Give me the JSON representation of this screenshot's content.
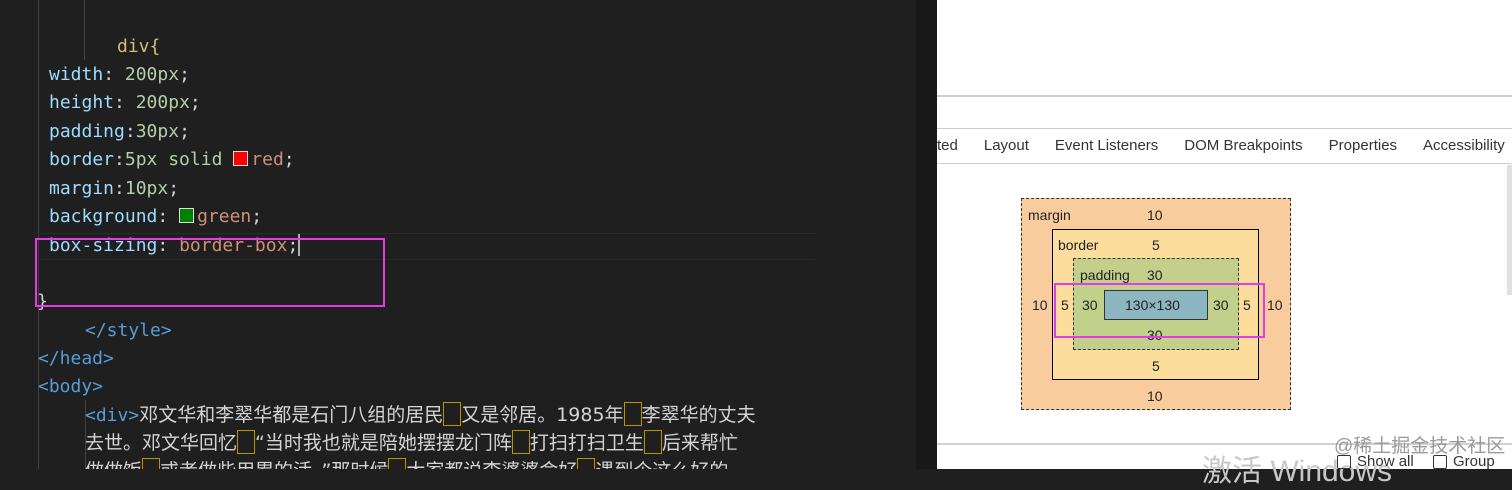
{
  "editor": {
    "selector": "div{",
    "decls": [
      {
        "prop": "width",
        "sep": ": ",
        "value": "200px",
        "end": ";"
      },
      {
        "prop": "height",
        "sep": ": ",
        "value": "200px",
        "end": ";"
      },
      {
        "prop": "padding",
        "sep": ":",
        "value": "30px",
        "end": ";"
      },
      {
        "prop": "border",
        "sep": ":",
        "value": "5px solid",
        "swatch": "#ff0000",
        "value2": "red",
        "end": ";"
      },
      {
        "prop": "margin",
        "sep": ":",
        "value": "10px",
        "end": ";"
      },
      {
        "prop": "background",
        "sep": ": ",
        "swatch": "#008000",
        "value2": "green",
        "end": ";"
      },
      {
        "prop": "box-sizing",
        "sep": ": ",
        "value": "border-box",
        "end": ";"
      }
    ],
    "close_brace": "}",
    "style_close": "</style>",
    "head_close": "</head>",
    "body_open": "<body>",
    "div_open": "<div>",
    "text_lines": [
      [
        "邓文华和李翠华都是石门八组的居民",
        "，",
        "又是邻居。1985年",
        "，",
        "李翠华的丈夫"
      ],
      [
        "去世。邓文华回忆",
        "，",
        "“当时我也就是陪她摆摆龙门阵",
        "，",
        "打扫打扫卫生",
        "，",
        "后来帮忙"
      ],
      [
        "做做饭",
        "，",
        "或者做些用累的活。”那时候",
        "，",
        "大家都说李婆婆命好",
        "，",
        "遇到个这么好的"
      ]
    ]
  },
  "devtools": {
    "tabs": [
      "ted",
      "Layout",
      "Event Listeners",
      "DOM Breakpoints",
      "Properties",
      "Accessibility"
    ],
    "box_model": {
      "margin_label": "margin",
      "margin": {
        "top": "10",
        "right": "10",
        "bottom": "10",
        "left": "10"
      },
      "border_label": "border",
      "border": {
        "top": "5",
        "right": "5",
        "bottom": "5",
        "left": "5"
      },
      "padding_label": "padding",
      "padding": {
        "top": "30",
        "right": "30",
        "bottom": "30",
        "left": "30"
      },
      "content": "130×130"
    },
    "show_all": "Show all",
    "group": "Group"
  },
  "watermark": {
    "activate": "激活 Windows",
    "site": "@稀土掘金技术社区"
  }
}
